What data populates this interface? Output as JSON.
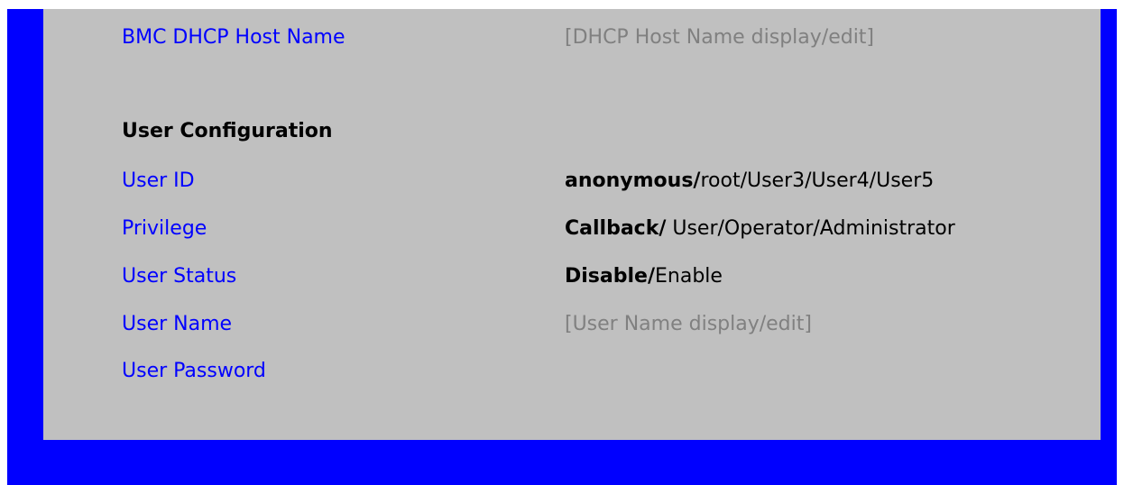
{
  "colors": {
    "frame": "#0000ff",
    "panel": "#c0c0c0",
    "label": "#0000ff",
    "placeholder": "#808080",
    "text": "#000000"
  },
  "bmc_dhcp_host_name": {
    "label": "BMC DHCP Host Name",
    "value": "[DHCP Host Name display/edit]"
  },
  "user_configuration": {
    "heading": "User Configuration",
    "user_id": {
      "label": "User ID",
      "selected": "anonymous/",
      "rest": "root/User3/User4/User5"
    },
    "privilege": {
      "label": "Privilege",
      "selected": "Callback/",
      "rest": " User/Operator/Administrator"
    },
    "user_status": {
      "label": "User Status",
      "selected": "Disable/",
      "rest": "Enable"
    },
    "user_name": {
      "label": "User Name",
      "value": "[User Name display/edit]"
    },
    "user_password": {
      "label": "User Password"
    }
  }
}
